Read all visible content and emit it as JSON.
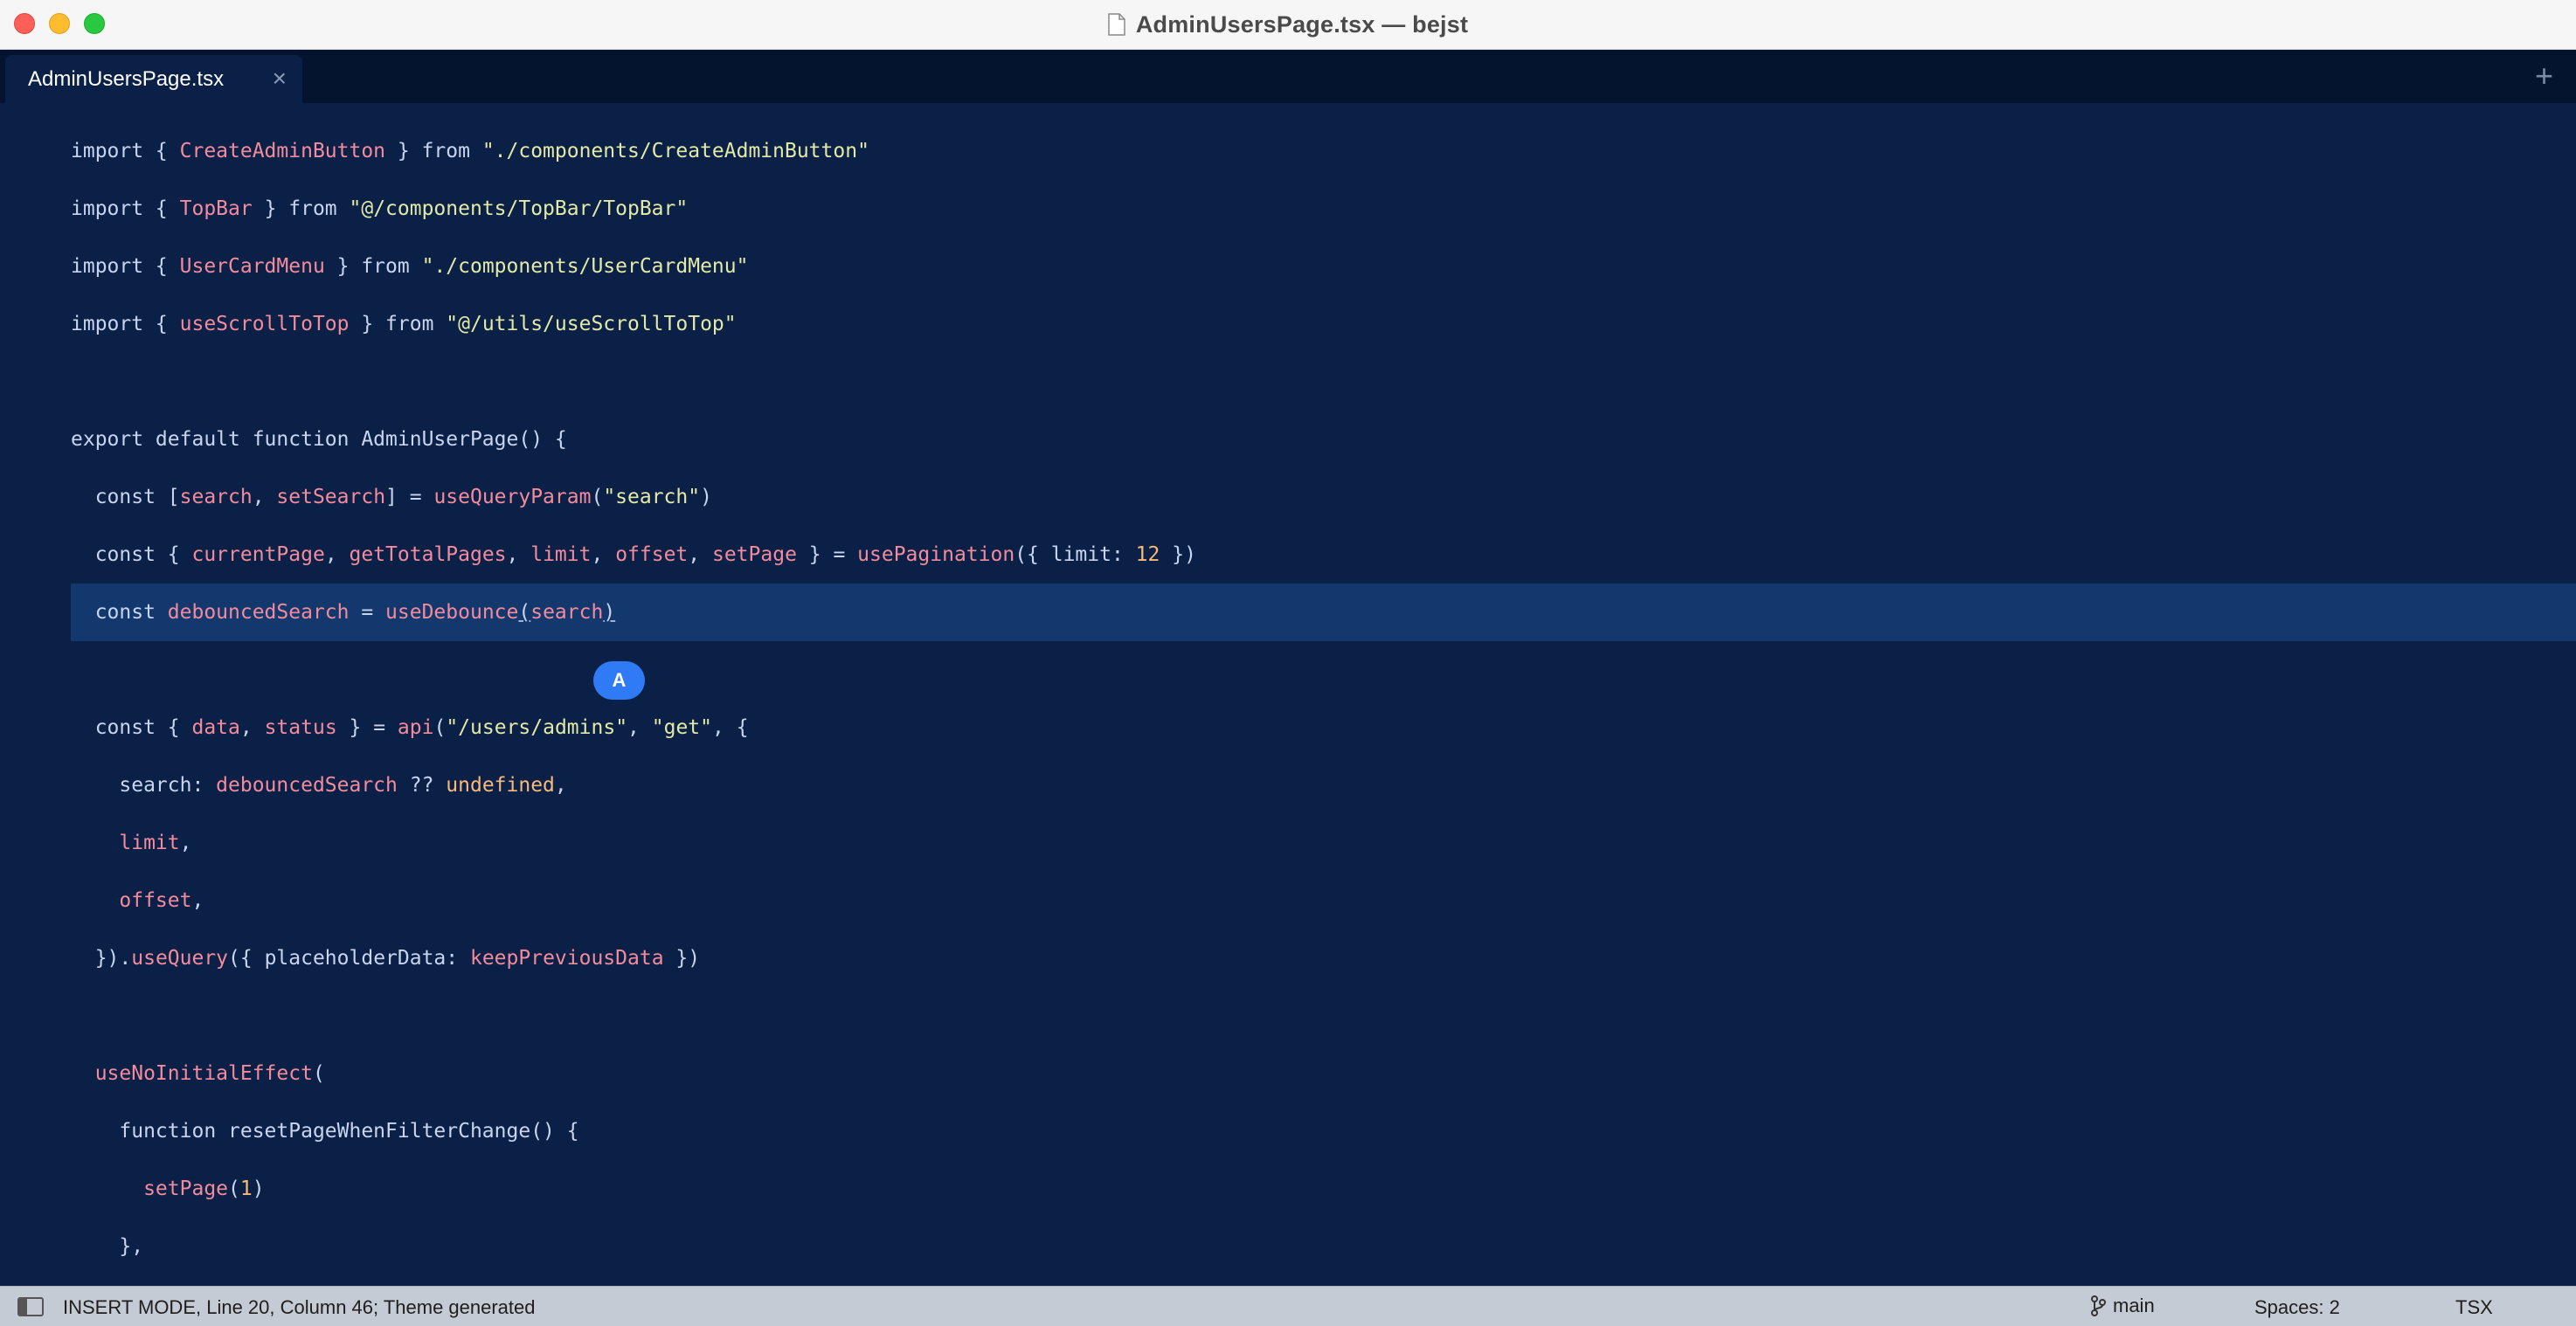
{
  "window": {
    "title": "AdminUsersPage.tsx — bejst"
  },
  "tabs": [
    {
      "label": "AdminUsersPage.tsx",
      "close": "×"
    }
  ],
  "new_tab": "+",
  "editor": {
    "badge": "A",
    "lines": [
      [
        [
          "k",
          "import { "
        ],
        [
          "id",
          "CreateAdminButton"
        ],
        [
          "k",
          " } from "
        ],
        [
          "str",
          "\"./components/CreateAdminButton\""
        ]
      ],
      [
        [
          "k",
          "import { "
        ],
        [
          "id",
          "TopBar"
        ],
        [
          "k",
          " } from "
        ],
        [
          "str",
          "\"@/components/TopBar/TopBar\""
        ]
      ],
      [
        [
          "k",
          "import { "
        ],
        [
          "id",
          "UserCardMenu"
        ],
        [
          "k",
          " } from "
        ],
        [
          "str",
          "\"./components/UserCardMenu\""
        ]
      ],
      [
        [
          "k",
          "import { "
        ],
        [
          "id",
          "useScrollToTop"
        ],
        [
          "k",
          " } from "
        ],
        [
          "str",
          "\"@/utils/useScrollToTop\""
        ]
      ],
      [],
      [
        [
          "k",
          "export default function AdminUserPage() {"
        ]
      ],
      [
        [
          "k",
          "  const ["
        ],
        [
          "id",
          "search"
        ],
        [
          "k",
          ", "
        ],
        [
          "id",
          "setSearch"
        ],
        [
          "k",
          "] = "
        ],
        [
          "fn",
          "useQueryParam"
        ],
        [
          "k",
          "("
        ],
        [
          "str",
          "\"search\""
        ],
        [
          "k",
          ")"
        ]
      ],
      [
        [
          "k",
          "  const { "
        ],
        [
          "id",
          "currentPage"
        ],
        [
          "k",
          ", "
        ],
        [
          "id",
          "getTotalPages"
        ],
        [
          "k",
          ", "
        ],
        [
          "id",
          "limit"
        ],
        [
          "k",
          ", "
        ],
        [
          "id",
          "offset"
        ],
        [
          "k",
          ", "
        ],
        [
          "id",
          "setPage"
        ],
        [
          "k",
          " } = "
        ],
        [
          "fn",
          "usePagination"
        ],
        [
          "k",
          "({ limit: "
        ],
        [
          "num",
          "12"
        ],
        [
          "k",
          " })"
        ]
      ],
      [
        [
          "k",
          "  const "
        ],
        [
          "id",
          "debouncedSearch"
        ],
        [
          "k",
          " = "
        ],
        [
          "fn",
          "useDebounce"
        ],
        [
          "under",
          "("
        ],
        [
          "fn",
          "search"
        ],
        [
          "under",
          ")"
        ]
      ],
      [],
      [
        [
          "k",
          "  const { "
        ],
        [
          "id",
          "data"
        ],
        [
          "k",
          ", "
        ],
        [
          "id",
          "status"
        ],
        [
          "k",
          " } = "
        ],
        [
          "fn",
          "api"
        ],
        [
          "k",
          "("
        ],
        [
          "str",
          "\"/users/admins\""
        ],
        [
          "k",
          ", "
        ],
        [
          "str",
          "\"get\""
        ],
        [
          "k",
          ", {"
        ]
      ],
      [
        [
          "k",
          "    search: "
        ],
        [
          "id",
          "debouncedSearch"
        ],
        [
          "k",
          " ?? "
        ],
        [
          "num",
          "undefined"
        ],
        [
          "k",
          ","
        ]
      ],
      [
        [
          "id",
          "    limit"
        ],
        [
          "k",
          ","
        ]
      ],
      [
        [
          "id",
          "    offset"
        ],
        [
          "k",
          ","
        ]
      ],
      [
        [
          "k",
          "  })."
        ],
        [
          "fn",
          "useQuery"
        ],
        [
          "k",
          "({ placeholderData: "
        ],
        [
          "id",
          "keepPreviousData"
        ],
        [
          "k",
          " })"
        ]
      ],
      [],
      [
        [
          "fn",
          "  useNoInitialEffect"
        ],
        [
          "k",
          "("
        ]
      ],
      [
        [
          "k",
          "    function resetPageWhenFilterChange() {"
        ]
      ],
      [
        [
          "fn",
          "      setPage"
        ],
        [
          "k",
          "("
        ],
        [
          "num",
          "1"
        ],
        [
          "k",
          ")"
        ]
      ],
      [
        [
          "k",
          "    },"
        ]
      ]
    ]
  },
  "status": {
    "mode_text": "INSERT MODE, Line 20, Column 46; Theme generated",
    "branch": "main",
    "spaces": "Spaces: 2",
    "syntax": "TSX"
  }
}
